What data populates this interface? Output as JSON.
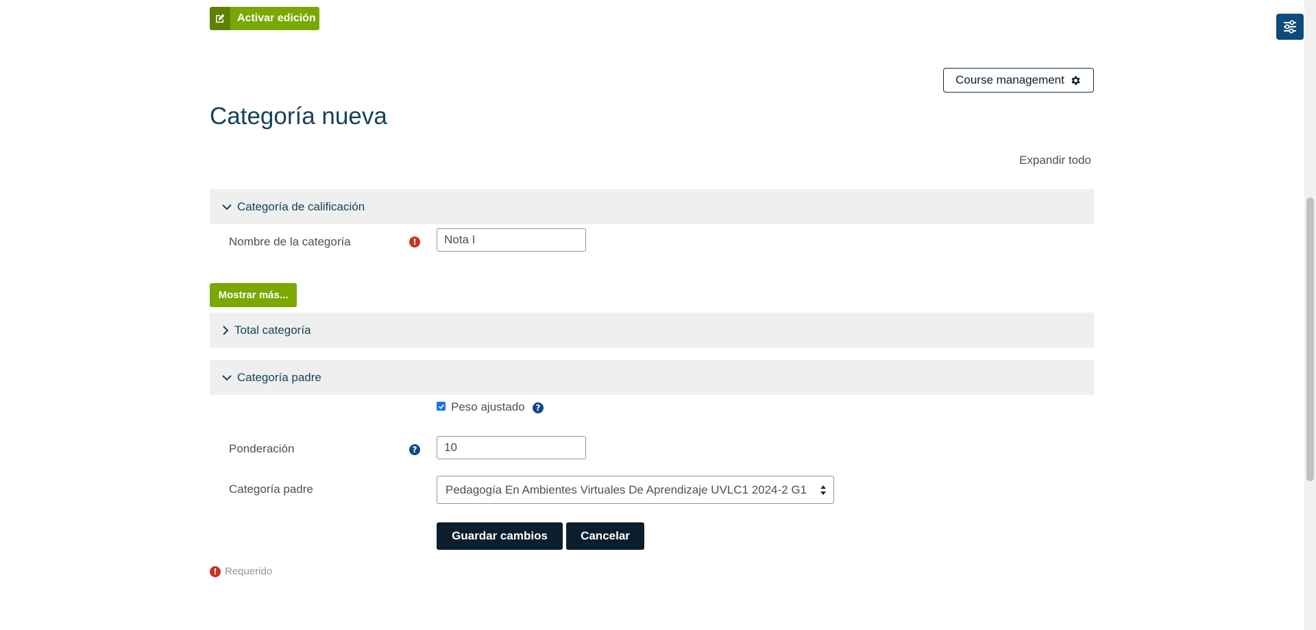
{
  "edit_toggle": {
    "label": "Activar edición",
    "icon": "edit-icon"
  },
  "drawer_toggle": {
    "icon": "sliders-icon"
  },
  "course_management": {
    "label": "Course management",
    "icon": "gear-icon"
  },
  "page": {
    "title": "Categoría nueva",
    "expand_all": "Expandir todo"
  },
  "sections": {
    "grade_category": {
      "title": "Categoría de calificación",
      "expanded": true
    },
    "category_total": {
      "title": "Total categoría",
      "expanded": false
    },
    "parent_category": {
      "title": "Categoría padre",
      "expanded": true
    }
  },
  "form": {
    "category_name": {
      "label": "Nombre de la categoría",
      "value": "Nota I",
      "required": true
    },
    "show_more": "Mostrar más...",
    "adjusted_weight": {
      "label": "Peso ajustado",
      "checked": true
    },
    "weight": {
      "label": "Ponderación",
      "value": "10"
    },
    "parent_category": {
      "label": "Categoría padre",
      "selected": "Pedagogía En Ambientes Virtuales De Aprendizaje UVLC1 2024-2 G1"
    },
    "save_label": "Guardar cambios",
    "cancel_label": "Cancelar",
    "required_note": "Requerido"
  },
  "colors": {
    "accent_green": "#7aa800",
    "title_blue": "#16425b",
    "dark_button": "#0b1e2d",
    "required_red": "#ca3120",
    "help_blue": "#0f4a8a"
  }
}
